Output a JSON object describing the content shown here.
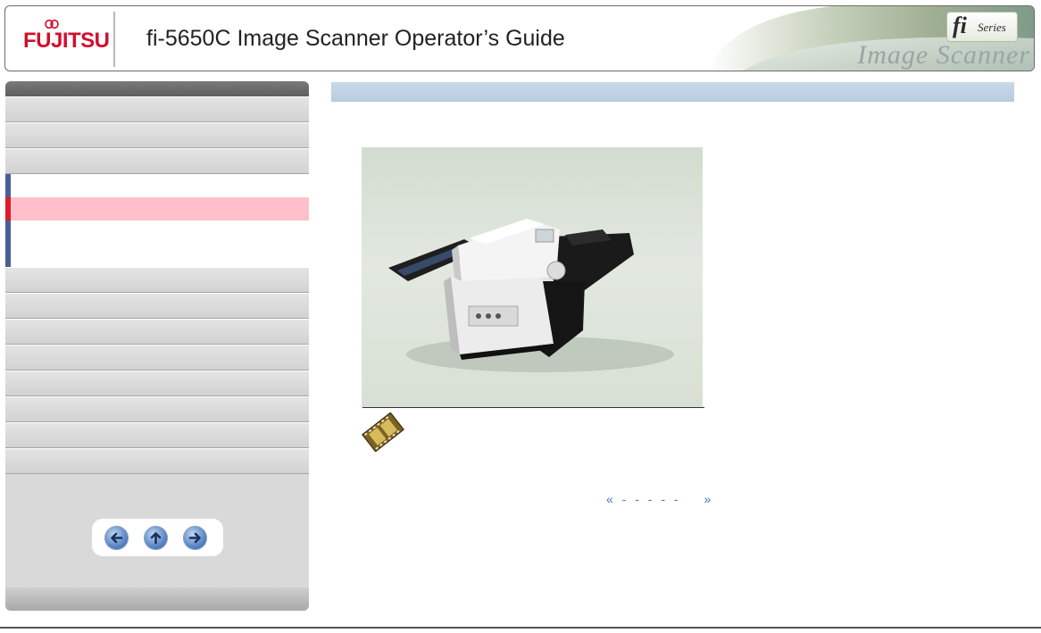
{
  "header": {
    "logo_text": "FUJITSU",
    "title": "fi-5650C Image Scanner Operator’s Guide",
    "brand_fi": "fi",
    "brand_series": "Series",
    "brand_script": "Image Scanner"
  },
  "sidebar": {
    "active_index": 5,
    "colors": {
      "active_bg": "#ffc0cb",
      "active_marker": "#e01a2b",
      "section_marker": "#4a5f9a"
    },
    "nav_buttons": [
      {
        "name": "previous-page",
        "icon": "left-arrow-icon"
      },
      {
        "name": "top-page",
        "icon": "up-arrow-icon"
      },
      {
        "name": "next-page",
        "icon": "right-arrow-icon"
      }
    ]
  },
  "main": {
    "section_bar_color": "#c2d4e6",
    "image": {
      "subject": "fi-5650C scanner photo"
    },
    "movie_icon": "film-strip-icon",
    "pager": {
      "prev": "«",
      "dashes": "- - - - -",
      "next": "»",
      "color": "#4a70c2"
    }
  }
}
